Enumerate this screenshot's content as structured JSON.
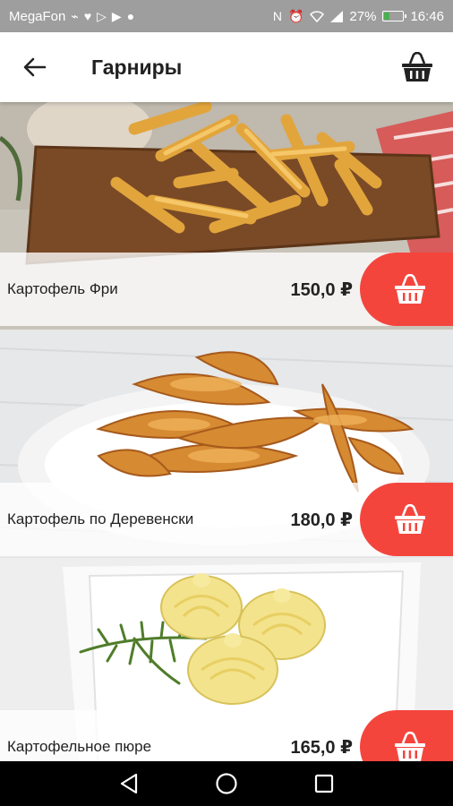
{
  "status_bar": {
    "carrier": "MegaFon",
    "battery_percent": "27%",
    "battery_level": 0.27,
    "time": "16:46",
    "icons": [
      "usb-icon",
      "heart-icon",
      "play-icon",
      "play-icon",
      "chat-icon",
      "nfc-icon",
      "alarm-icon",
      "wifi-icon",
      "signal-icon",
      "battery-icon"
    ]
  },
  "header": {
    "title": "Гарниры",
    "back_icon": "arrow-back-icon",
    "cart_icon": "basket-icon"
  },
  "items": [
    {
      "name": "Картофель Фри",
      "price": "150,0 ₽",
      "image": "french-fries"
    },
    {
      "name": "Картофель по Деревенски",
      "price": "180,0 ₽",
      "image": "potato-wedges"
    },
    {
      "name": "Картофельное пюре",
      "price": "165,0 ₽",
      "image": "mashed-potatoes"
    }
  ],
  "nav": {
    "back": "nav-back-icon",
    "home": "nav-home-icon",
    "recents": "nav-recents-icon"
  },
  "colors": {
    "accent": "#f4453d",
    "status_bar": "#9e9e9e",
    "title": "#212121"
  }
}
